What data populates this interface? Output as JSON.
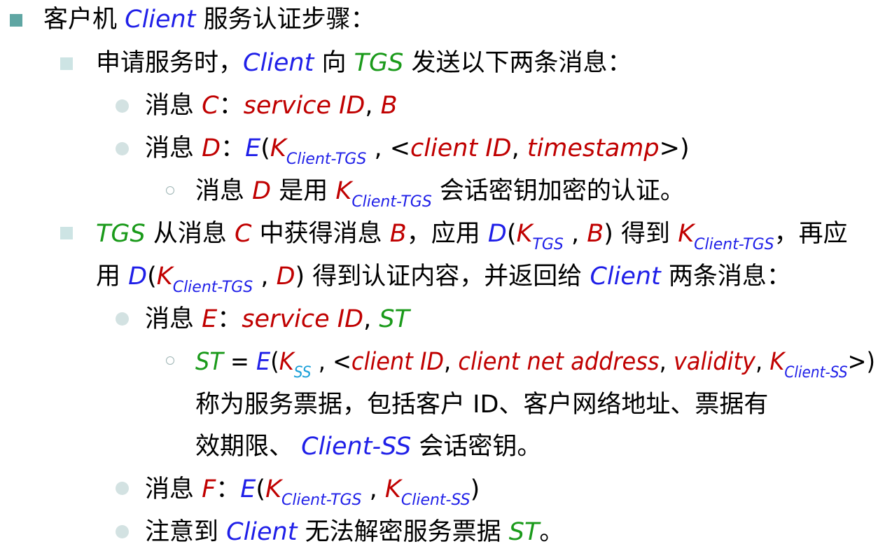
{
  "l1": [
    "客户机 ",
    "Client",
    " 服务认证步骤："
  ],
  "l2": [
    "申请服务时，",
    "Client",
    " 向 ",
    "TGS",
    " 发送以下两条消息："
  ],
  "l3": [
    "消息 ",
    "C",
    "：",
    "service ID",
    ", ",
    "B"
  ],
  "l4": [
    "消息 ",
    "D",
    "：",
    "E",
    "(",
    "K",
    "Client-TGS",
    " , <",
    "client ID",
    ", ",
    "timestamp",
    ">)"
  ],
  "l5": [
    "消息 ",
    "D",
    " 是用 ",
    "K",
    "Client-TGS",
    " 会话密钥加密的认证。"
  ],
  "l6": [
    "TGS",
    " 从消息 ",
    "C",
    " 中获得消息 ",
    "B",
    "，应用 ",
    "D",
    "(",
    "K",
    "TGS",
    " , ",
    "B",
    ") 得到 ",
    "K",
    "Client-TGS",
    "，再应"
  ],
  "l7": [
    "用 ",
    "D",
    "(",
    "K",
    "Client-TGS",
    " , ",
    "D",
    ") 得到认证内容，并返回给 ",
    "Client",
    " 两条消息："
  ],
  "l8": [
    "消息 ",
    "E",
    "：",
    "service ID",
    ", ",
    "ST"
  ],
  "l9": [
    "ST",
    " = ",
    "E",
    "(",
    "K",
    "SS",
    " , <",
    "client ID",
    ", ",
    "client net address",
    ", ",
    "validity",
    ", ",
    "K",
    "Client-SS",
    ">)"
  ],
  "l10": [
    "称为服务票据，包括客户 ID、客户网络地址、票据有"
  ],
  "l11": [
    "效期限、 ",
    "Client-SS",
    " 会话密钥。"
  ],
  "l12": [
    "消息 ",
    "F",
    "：",
    "E",
    "(",
    "K",
    "Client-TGS",
    " , ",
    "K",
    "Client-SS",
    ")"
  ],
  "l13": [
    "注意到 ",
    "Client",
    " 无法解密服务票据 ",
    "ST",
    "。"
  ]
}
